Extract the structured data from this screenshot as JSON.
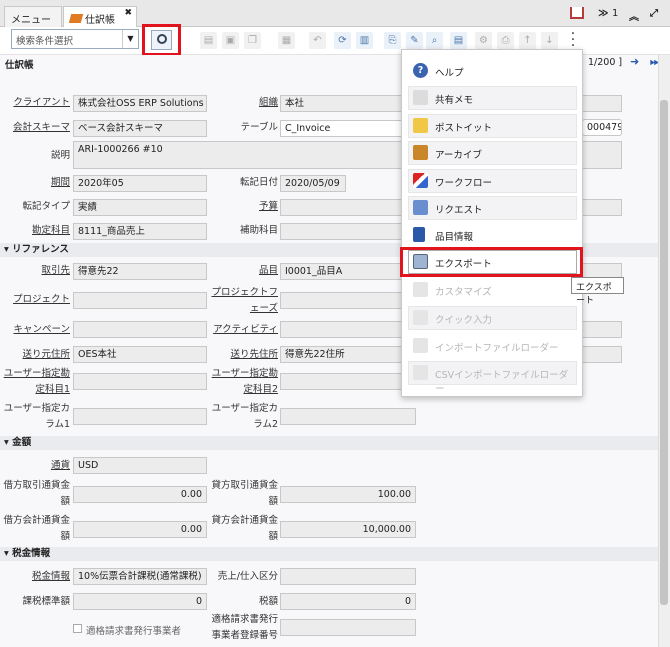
{
  "tabs": {
    "menu": "メニュー",
    "journal": "仕訳帳",
    "close": "✖"
  },
  "topright": {
    "count": "1"
  },
  "search": {
    "placeholder": "検索条件選択"
  },
  "window": {
    "title": "仕訳帳",
    "record_nav": "1/200 ]"
  },
  "fields": {
    "client_label": "クライアント",
    "client_value": "株式会社OSS ERP Solutions",
    "org_label": "組織",
    "org_value": "本社",
    "schema_label": "会計スキーマ",
    "schema_value": "ベース会計スキーマ",
    "table_label": "テーブル",
    "table_value": "C_Invoice",
    "record_value": "000479)",
    "desc_label": "説明",
    "desc_value": "ARI-1000266 #10",
    "period_label": "期間",
    "period_value": "2020年05",
    "postdate_label": "転記日付",
    "postdate_value": "2020/05/09",
    "posttype_label": "転記タイプ",
    "posttype_value": "実績",
    "budget_label": "予算",
    "account_label": "勘定科目",
    "account_value": "8111_商品売上",
    "subaccount_label": "補助科目"
  },
  "ref": {
    "header": "リファレンス",
    "bp_label": "取引先",
    "bp_value": "得意先22",
    "product_label": "品目",
    "product_value": "I0001_品目A",
    "project_label": "プロジェクト",
    "projectphase_label1": "プロジェクトフ",
    "projectphase_label2": "ェーズ",
    "campaign_label": "キャンペーン",
    "activity_label": "アクティビティ",
    "shipfrom_label": "送り元住所",
    "shipfrom_value": "OES本社",
    "shipto_label": "送り先住所",
    "shipto_value": "得意先22住所",
    "ua1_label1": "ユーザー指定勘",
    "ua1_label2": "定科目1",
    "ua2_label1": "ユーザー指定勘",
    "ua2_label2": "定科目2",
    "ucol1_label1": "ユーザー指定カ",
    "ucol1_label2": "ラム1",
    "ucol2_label1": "ユーザー指定カ",
    "ucol2_label2": "ラム2"
  },
  "amount": {
    "header": "金額",
    "currency_label": "通貨",
    "currency_value": "USD",
    "dr_src_label1": "借方取引通貨金",
    "dr_src_label2": "額",
    "dr_src_value": "0.00",
    "cr_src_label1": "貸方取引通貨金",
    "cr_src_label2": "額",
    "cr_src_value": "100.00",
    "dr_acct_label1": "借方会計通貨金",
    "dr_acct_label2": "額",
    "dr_acct_value": "0.00",
    "cr_acct_label1": "貸方会計通貨金",
    "cr_acct_label2": "額",
    "cr_acct_value": "10,000.00"
  },
  "tax": {
    "header": "税金情報",
    "taxinfo_label": "税金情報",
    "taxinfo_value": "10%伝票合計課税(通常課税)",
    "sales_label": "売上/仕入区分",
    "taxbase_label": "課税標準額",
    "taxbase_value": "0",
    "taxamt_label": "税額",
    "taxamt_value": "0",
    "invoice_issuer_label": "適格請求書発行事業者",
    "reg_label1": "適格請求書発行",
    "reg_label2": "事業者登録番号"
  },
  "menu": {
    "help": "ヘルプ",
    "chat": "共有メモ",
    "postit": "ポストイット",
    "archive": "アーカイブ",
    "workflow": "ワークフロー",
    "request": "リクエスト",
    "productinfo": "品目情報",
    "export": "エクスポート",
    "customize": "カスタマイズ",
    "quickentry": "クイック入力",
    "fileimport": "インポートファイルローダー",
    "csvimport": "CSVインポートファイルローダー"
  },
  "tooltip": "エクスポート",
  "colors": {
    "accent": "#e1141e",
    "link": "#2a5db0"
  }
}
